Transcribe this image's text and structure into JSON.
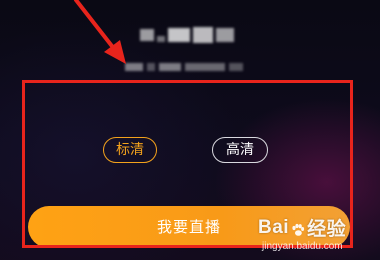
{
  "quality": {
    "options": [
      {
        "label": "标清",
        "selected": true
      },
      {
        "label": "高清",
        "selected": false
      }
    ]
  },
  "actions": {
    "start_live_label": "我要直播"
  },
  "watermark": {
    "logo_left": "Bai",
    "logo_right": "经验",
    "url": "jingyan.baidu.com"
  },
  "colors": {
    "accent": "#f3a21c",
    "annotation": "#e8241c",
    "background": "#0b0a16"
  }
}
